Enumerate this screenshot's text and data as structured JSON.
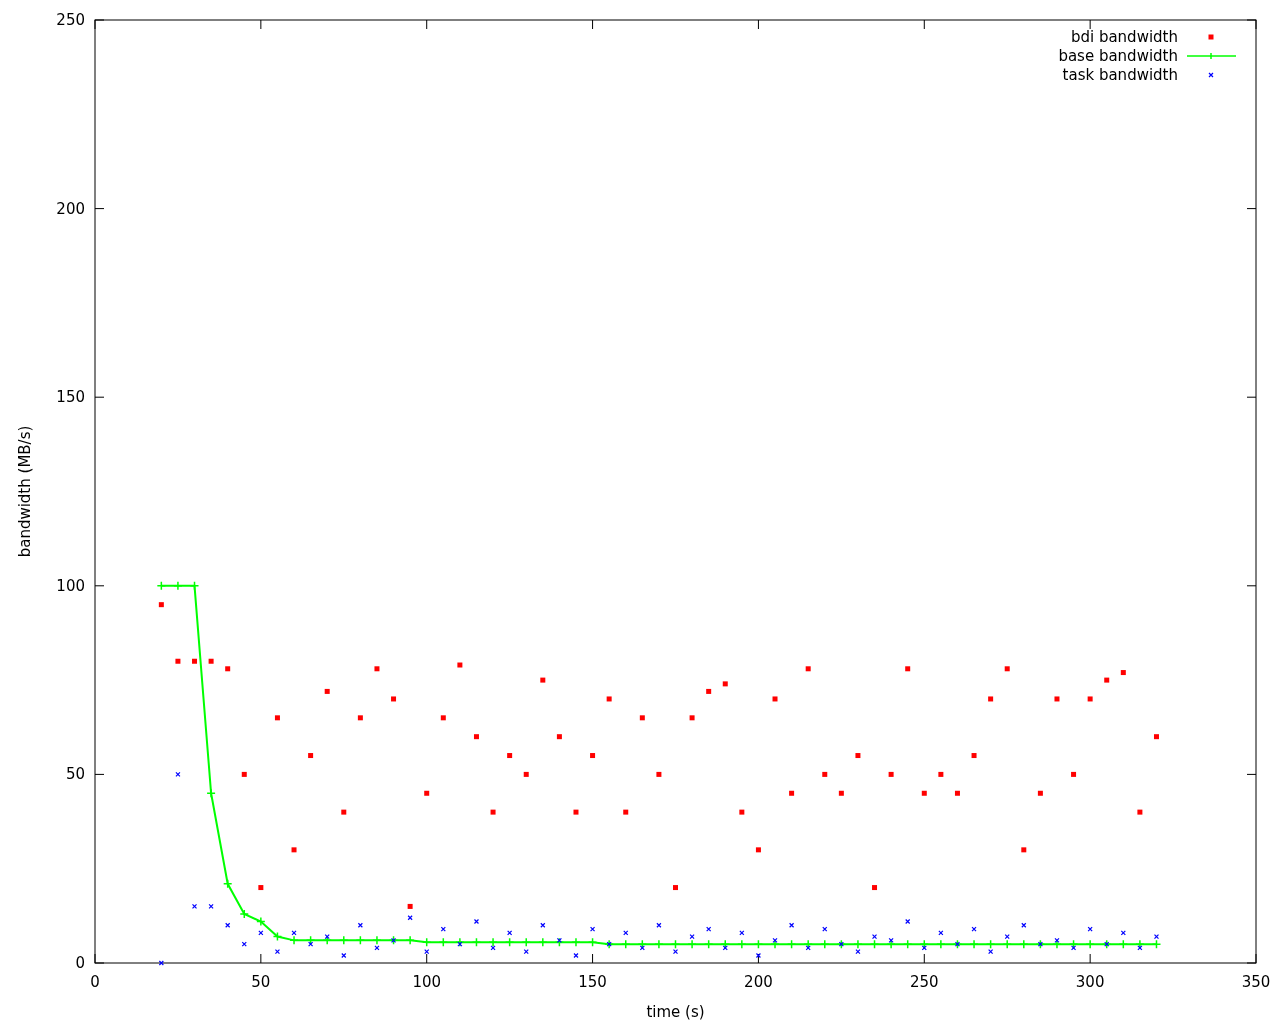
{
  "chart_data": {
    "type": "scatter",
    "legend": true,
    "xlabel": "time (s)",
    "ylabel": "bandwidth (MB/s)",
    "xlim": [
      0,
      350
    ],
    "ylim": [
      0,
      250
    ],
    "xticks": [
      0,
      50,
      100,
      150,
      200,
      250,
      300,
      350
    ],
    "yticks": [
      0,
      50,
      100,
      150,
      200,
      250
    ],
    "x": [
      20,
      25,
      30,
      35,
      40,
      45,
      50,
      55,
      60,
      65,
      70,
      75,
      80,
      85,
      90,
      95,
      100,
      105,
      110,
      115,
      120,
      125,
      130,
      135,
      140,
      145,
      150,
      155,
      160,
      165,
      170,
      175,
      180,
      185,
      190,
      195,
      200,
      205,
      210,
      215,
      220,
      225,
      230,
      235,
      240,
      245,
      250,
      255,
      260,
      265,
      270,
      275,
      280,
      285,
      290,
      295,
      300,
      305,
      310,
      315,
      320
    ],
    "series": [
      {
        "name": "bdi bandwidth",
        "color": "#ff0000",
        "marker": "square",
        "values": [
          95,
          80,
          80,
          80,
          78,
          50,
          20,
          65,
          30,
          55,
          72,
          40,
          65,
          78,
          70,
          15,
          45,
          65,
          79,
          60,
          40,
          55,
          50,
          75,
          60,
          40,
          55,
          70,
          40,
          65,
          50,
          20,
          65,
          72,
          74,
          40,
          30,
          70,
          45,
          78,
          50,
          45,
          55,
          20,
          50,
          78,
          45,
          50,
          45,
          55,
          70,
          78,
          30,
          45,
          70,
          50,
          70,
          75,
          77,
          40,
          60
        ]
      },
      {
        "name": "base bandwidth",
        "color": "#00ff00",
        "type": "line",
        "marker": "plus",
        "values": [
          100,
          100,
          100,
          45,
          21,
          13,
          11,
          7,
          6,
          6,
          6,
          6,
          6,
          6,
          6,
          6,
          5.5,
          5.5,
          5.5,
          5.5,
          5.5,
          5.5,
          5.5,
          5.5,
          5.5,
          5.5,
          5.5,
          5,
          5,
          5,
          5,
          5,
          5,
          5,
          5,
          5,
          5,
          5,
          5,
          5,
          5,
          5,
          5,
          5,
          5,
          5,
          5,
          5,
          5,
          5,
          5,
          5,
          5,
          5,
          5,
          5,
          5,
          5,
          5,
          5,
          5
        ]
      },
      {
        "name": "task bandwidth",
        "color": "#0000ff",
        "marker": "x",
        "values": [
          0,
          50,
          15,
          15,
          10,
          5,
          8,
          3,
          8,
          5,
          7,
          2,
          10,
          4,
          6,
          12,
          3,
          9,
          5,
          11,
          4,
          8,
          3,
          10,
          6,
          2,
          9,
          5,
          8,
          4,
          10,
          3,
          7,
          9,
          4,
          8,
          2,
          6,
          10,
          4,
          9,
          5,
          3,
          7,
          6,
          11,
          4,
          8,
          5,
          9,
          3,
          7,
          10,
          5,
          6,
          4,
          9,
          5,
          8,
          4,
          7
        ]
      }
    ]
  }
}
